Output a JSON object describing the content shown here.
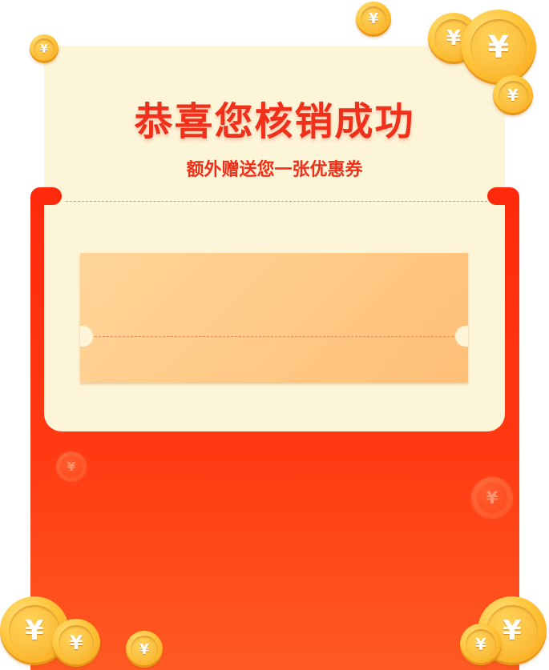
{
  "dialog": {
    "title": "恭喜您核销成功",
    "subtitle": "额外赠送您一张优惠券"
  },
  "colors": {
    "accent_red": "#f0301a",
    "envelope_red": "#ff2a0c",
    "cream": "#fdf5d8",
    "coupon_gold": "#ffc884"
  },
  "icons": {
    "coin_glyph": "¥"
  }
}
